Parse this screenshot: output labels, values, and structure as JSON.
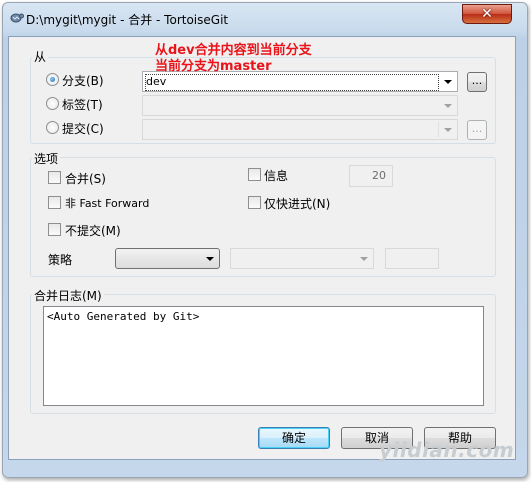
{
  "window": {
    "title": "D:\\mygit\\mygit - 合并 - TortoiseGit",
    "close_label": "✕"
  },
  "annotation": {
    "line1": "从dev合并内容到当前分支",
    "line2": "当前分支为master"
  },
  "from_group": {
    "label": "从",
    "branch_label": "分支(B)",
    "branch_value": "dev",
    "tag_label": "标签(T)",
    "commit_label": "提交(C)",
    "browse_label": "...",
    "browse2_label": "..."
  },
  "options_group": {
    "label": "选项",
    "squash_label": "合并(S)",
    "no_ff_label": "非 Fast Forward",
    "no_commit_label": "不提交(M)",
    "message_label": "信息",
    "message_count": "20",
    "ff_only_label": "仅快进式(N)",
    "strategy_label": "策略"
  },
  "log_group": {
    "label": "合并日志(M)",
    "text": "<Auto Generated by Git>"
  },
  "buttons": {
    "ok": "确定",
    "cancel": "取消",
    "help": "帮助"
  },
  "watermark": "yiidian.com",
  "colors": {
    "annotation": "#e8141a",
    "close_button": "#c8412a",
    "default_button": "#3c7fb1"
  }
}
